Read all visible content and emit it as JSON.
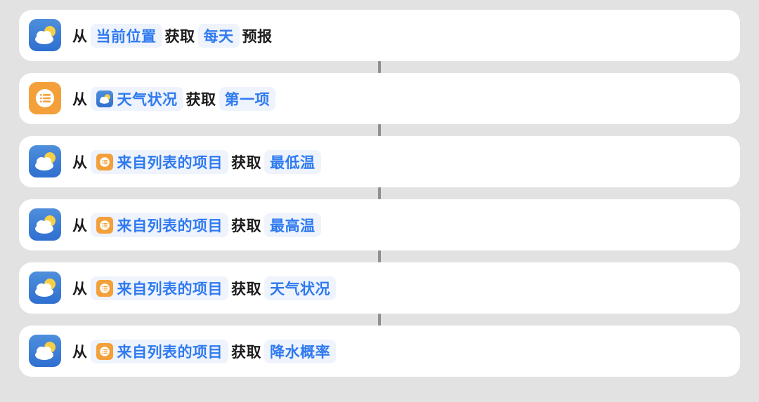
{
  "colors": {
    "background": "#e3e2e2",
    "card": "#ffffff",
    "token_bg": "#eef3fc",
    "token_text": "#2f7af0",
    "weather_icon_top": "#4f8fdc",
    "weather_icon_bottom": "#2f6fd0",
    "list_icon": "#f3a03a",
    "connector": "#8e8e93"
  },
  "actions": [
    {
      "icon": "weather-icon",
      "from_word": "从",
      "source": {
        "label": "当前位置",
        "icon": null
      },
      "get_word": "获取",
      "target": {
        "label": "每天"
      },
      "suffix": "预报"
    },
    {
      "icon": "list-icon",
      "from_word": "从",
      "source": {
        "label": "天气状况",
        "icon": "weather-icon"
      },
      "get_word": "获取",
      "target": {
        "label": "第一项"
      },
      "suffix": ""
    },
    {
      "icon": "weather-icon",
      "from_word": "从",
      "source": {
        "label": "来自列表的项目",
        "icon": "list-icon"
      },
      "get_word": "获取",
      "target": {
        "label": "最低温"
      },
      "suffix": ""
    },
    {
      "icon": "weather-icon",
      "from_word": "从",
      "source": {
        "label": "来自列表的项目",
        "icon": "list-icon"
      },
      "get_word": "获取",
      "target": {
        "label": "最高温"
      },
      "suffix": ""
    },
    {
      "icon": "weather-icon",
      "from_word": "从",
      "source": {
        "label": "来自列表的项目",
        "icon": "list-icon"
      },
      "get_word": "获取",
      "target": {
        "label": "天气状况"
      },
      "suffix": ""
    },
    {
      "icon": "weather-icon",
      "from_word": "从",
      "source": {
        "label": "来自列表的项目",
        "icon": "list-icon"
      },
      "get_word": "获取",
      "target": {
        "label": "降水概率"
      },
      "suffix": ""
    }
  ]
}
